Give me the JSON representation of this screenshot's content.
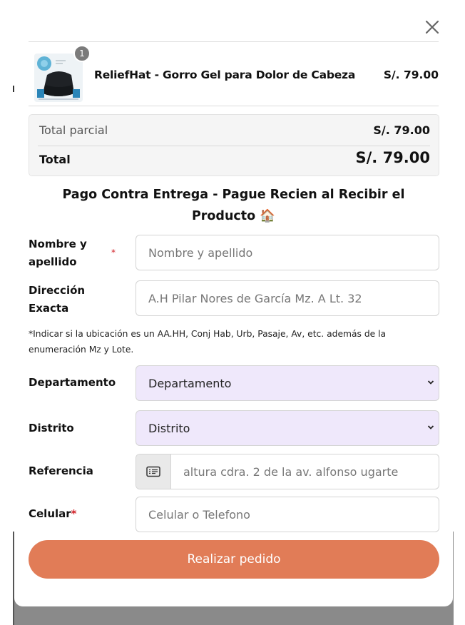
{
  "product": {
    "quantity": "1",
    "name": "ReliefHat - Gorro Gel para Dolor de Cabeza",
    "price": "S/. 79.00",
    "image_icon": "product-thumbnail"
  },
  "totals": {
    "subtotal_label": "Total parcial",
    "subtotal_value": "S/. 79.00",
    "total_label": "Total",
    "total_value": "S/. 79.00"
  },
  "form": {
    "heading": "Pago Contra Entrega - Pague Recien al Recibir el Producto 🏠",
    "name_label": "Nombre y apellido",
    "name_placeholder": "Nombre y apellido",
    "required_mark": "*",
    "address_label": "Dirección Exacta",
    "address_placeholder": "A.H Pilar Nores de García Mz. A Lt. 32",
    "address_hint": "*Indicar si la ubicación es un AA.HH, Conj Hab, Urb, Pasaje, Av, etc. además de la enumeración Mz y Lote.",
    "department_label": "Departamento",
    "department_value": "Departamento",
    "district_label": "Distrito",
    "district_value": "Distrito",
    "reference_label": "Referencia",
    "reference_placeholder": "altura cdra. 2 de la av. alfonso ugarte",
    "phone_label": "Celular",
    "phone_placeholder": "Celular o Telefono",
    "submit_label": "Realizar pedido"
  },
  "colors": {
    "accent": "#e17c57",
    "select_bg": "#efe8fb",
    "required": "#d2232a"
  }
}
